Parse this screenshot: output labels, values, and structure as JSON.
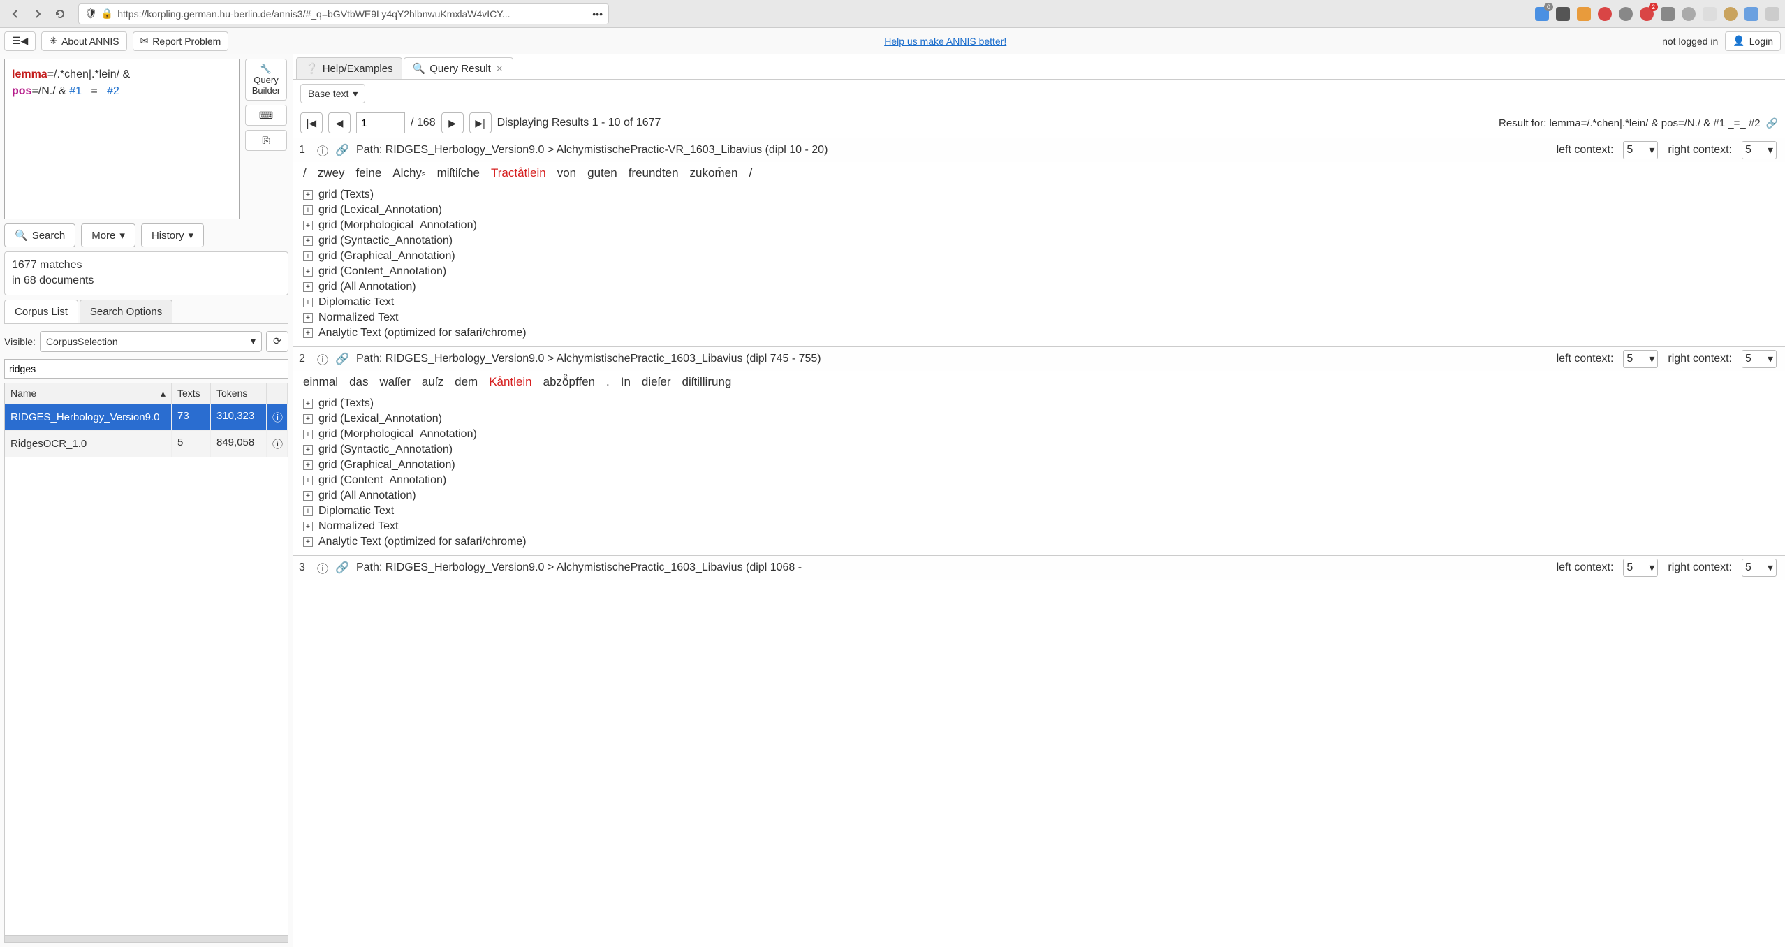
{
  "browser": {
    "url": "https://korpling.german.hu-berlin.de/annis3/#_q=bGVtbWE9Ly4qY2hlbnwuKmxlaW4vICY...",
    "badge1": "0",
    "badge2": "2"
  },
  "appbar": {
    "about": "About ANNIS",
    "report": "Report Problem",
    "help_link": "Help us make ANNIS better!",
    "not_logged": "not logged in",
    "login": "Login"
  },
  "query": {
    "line1_a": "lemma",
    "line1_b": "=/.*chen|.*lein/",
    "line1_c": " &",
    "line2_a": "pos",
    "line2_b": "=/N./",
    "line2_c": " & ",
    "line2_d": "#1",
    "line2_e": " _=_ ",
    "line2_f": "#2",
    "builder": "Query Builder",
    "search": "Search",
    "more": "More",
    "history": "History"
  },
  "status": {
    "matches": "1677 matches",
    "docs": "in 68 documents"
  },
  "tabs": {
    "corpus": "Corpus List",
    "options": "Search Options"
  },
  "visible": {
    "label": "Visible:",
    "value": "CorpusSelection"
  },
  "filter": "ridges",
  "table": {
    "col_name": "Name",
    "col_texts": "Texts",
    "col_tokens": "Tokens",
    "rows": [
      {
        "name": "RIDGES_Herbology_Version9.0",
        "texts": "73",
        "tokens": "310,323"
      },
      {
        "name": "RidgesOCR_1.0",
        "texts": "5",
        "tokens": "849,058"
      }
    ]
  },
  "rtabs": {
    "help": "Help/Examples",
    "result": "Query Result"
  },
  "base_text": "Base text",
  "pager": {
    "page": "1",
    "total": "/ 168",
    "displaying": "Displaying Results 1 - 10 of 1677",
    "result_for": "Result for: lemma=/.*chen|.*lein/ & pos=/N./ & #1 _=_ #2"
  },
  "context": {
    "left_label": "left context:",
    "right_label": "right context:",
    "left_val": "5",
    "right_val": "5"
  },
  "grids": [
    "grid (Texts)",
    "grid (Lexical_Annotation)",
    "grid (Morphological_Annotation)",
    "grid (Syntactic_Annotation)",
    "grid (Graphical_Annotation)",
    "grid (Content_Annotation)",
    "grid (All Annotation)",
    "Diplomatic Text",
    "Normalized Text",
    "Analytic Text (optimized for safari/chrome)"
  ],
  "results": [
    {
      "num": "1",
      "path": "Path: RIDGES_Herbology_Version9.0 > AlchymistischePractic-VR_1603_Libavius (dipl 10 - 20)",
      "tokens": [
        "/",
        "zwey",
        "feine",
        "Alchy⸗",
        "miſtiſche",
        "Tractåtlein",
        "von",
        "guten",
        "freundten",
        "zukom̄en",
        "/"
      ],
      "hit_index": 5
    },
    {
      "num": "2",
      "path": "Path: RIDGES_Herbology_Version9.0 > AlchymistischePractic_1603_Libavius (dipl 745 - 755)",
      "tokens": [
        "einmal",
        "das",
        "waſſer",
        "auſz",
        "dem",
        "Kåntlein",
        "abzoͤpffen",
        ".",
        "In",
        "dieſer",
        "diſtillirung"
      ],
      "hit_index": 5
    },
    {
      "num": "3",
      "path": "Path: RIDGES_Herbology_Version9.0 > AlchymistischePractic_1603_Libavius (dipl 1068 -",
      "tokens": [],
      "hit_index": -1
    }
  ]
}
